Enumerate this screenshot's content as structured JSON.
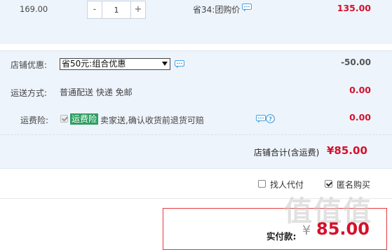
{
  "item": {
    "unit_price": "169.00",
    "quantity": "1",
    "minus_label": "-",
    "plus_label": "+",
    "discount_text": "省34:团购价",
    "subtotal": "135.00"
  },
  "store_discount": {
    "label": "店铺优惠:",
    "selected_option": "省50元:组合优惠",
    "amount": "-50.00"
  },
  "shipping": {
    "label": "运送方式:",
    "value": "普通配送 快递 免邮",
    "amount": "0.00"
  },
  "insurance": {
    "label": "运费险:",
    "tag": "运费险",
    "description": "卖家送,确认收货前退货可赔",
    "amount": "0.00"
  },
  "store_total": {
    "label": "店铺合计(含运费)",
    "amount": "¥85.00"
  },
  "options": {
    "proxy_pay": "找人代付",
    "anonymous": "匿名购买"
  },
  "payment": {
    "label": "实付款:",
    "currency": "¥",
    "amount": "85.00"
  },
  "colors": {
    "accent_red": "#d4112b",
    "row_blue": "#eef4fc",
    "tag_green": "#2e9e60",
    "chat_icon_blue": "#4aa3df"
  }
}
